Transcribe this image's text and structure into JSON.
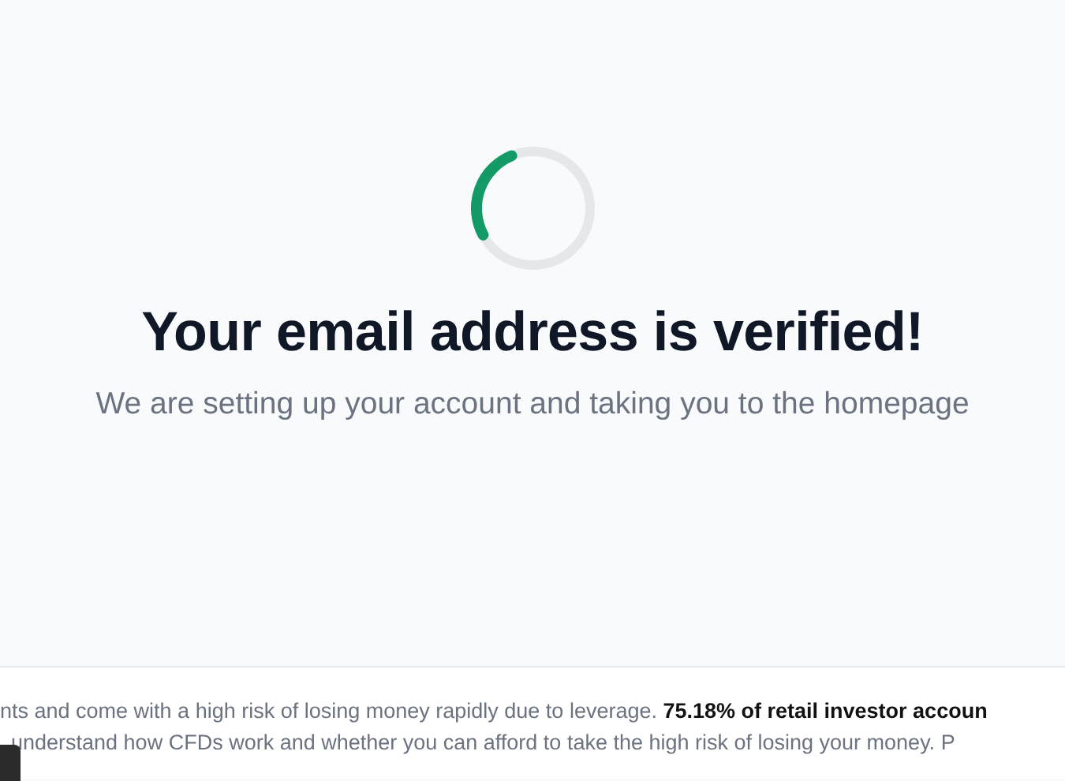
{
  "heading": "Your email address is verified!",
  "subheading": "We are setting up your account and taking you to the homepage",
  "risk_warning": {
    "lines": [
      "nts and come with a high risk of losing money rapidly due to leverage. **75.18% of retail investor accoun**",
      "understand how CFDs work and whether you can afford to take the high risk of losing your money. P"
    ]
  }
}
